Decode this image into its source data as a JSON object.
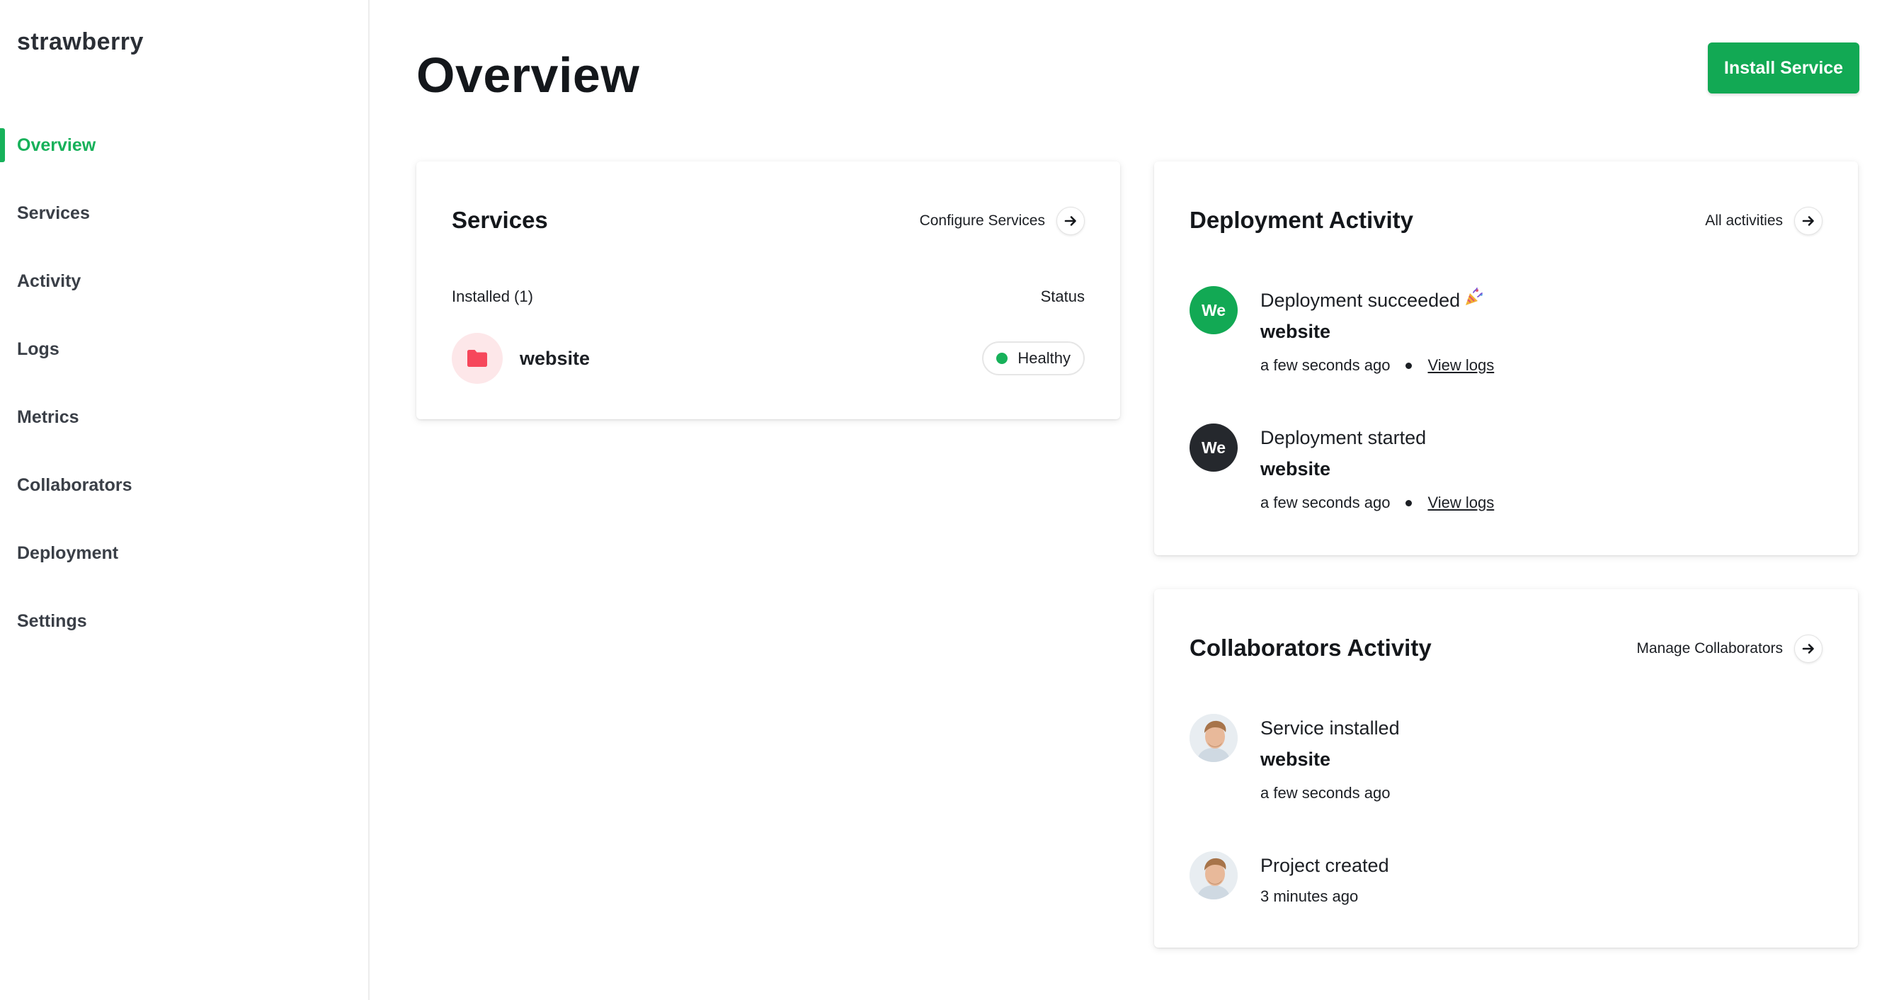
{
  "app": {
    "brand": "strawberry"
  },
  "sidebar": {
    "items": [
      {
        "label": "Overview",
        "active": true
      },
      {
        "label": "Services"
      },
      {
        "label": "Activity"
      },
      {
        "label": "Logs"
      },
      {
        "label": "Metrics"
      },
      {
        "label": "Collaborators"
      },
      {
        "label": "Deployment"
      },
      {
        "label": "Settings"
      }
    ]
  },
  "header": {
    "title": "Overview",
    "install_button": "Install Service"
  },
  "services_card": {
    "title": "Services",
    "link": "Configure Services",
    "installed_label": "Installed (1)",
    "status_label": "Status",
    "services": [
      {
        "name": "website",
        "status": "Healthy",
        "status_color": "#17b15a",
        "icon": "folder-icon"
      }
    ]
  },
  "deployment_card": {
    "title": "Deployment Activity",
    "link": "All activities",
    "entries": [
      {
        "avatar": "We",
        "avatar_color": "#12a954",
        "title": "Deployment succeeded",
        "emoji": "party-popper-icon",
        "target": "website",
        "time": "a few seconds ago",
        "action": "View logs"
      },
      {
        "avatar": "We",
        "avatar_color": "#25282d",
        "title": "Deployment started",
        "target": "website",
        "time": "a few seconds ago",
        "action": "View logs"
      }
    ]
  },
  "collaborators_card": {
    "title": "Collaborators Activity",
    "link": "Manage Collaborators",
    "entries": [
      {
        "avatar": "user-photo",
        "title": "Service installed",
        "target": "website",
        "time": "a few seconds ago"
      },
      {
        "avatar": "user-photo",
        "title": "Project created",
        "time": "3 minutes ago"
      }
    ]
  },
  "colors": {
    "accent": "#17b15a",
    "button": "#12a954"
  }
}
